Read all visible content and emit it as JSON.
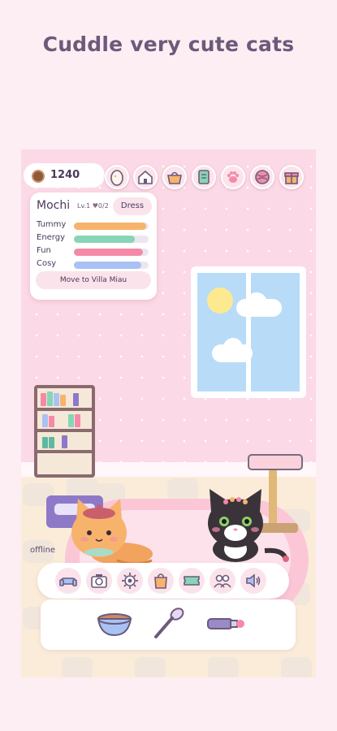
{
  "headline": "Cuddle very cute cats",
  "status": {
    "coins": "1240"
  },
  "top_icons": [
    "egg-icon",
    "home-icon",
    "basket-icon",
    "book-icon",
    "paw-icon",
    "yarn-ball-icon",
    "gift-icon"
  ],
  "cat_panel": {
    "name": "Mochi",
    "level": "Lv.1",
    "hearts": "0/2",
    "dress_label": "Dress",
    "stats": [
      {
        "label": "Tummy",
        "value": 0.97,
        "color": "#f7b36c"
      },
      {
        "label": "Energy",
        "value": 0.82,
        "color": "#86d5b6"
      },
      {
        "label": "Fun",
        "value": 0.92,
        "color": "#f48aa8"
      },
      {
        "label": "Cosy",
        "value": 0.9,
        "color": "#a9c2f4"
      }
    ],
    "move_label": "Move to Villa Miau"
  },
  "offline_label": "offline",
  "toolbar_icons": [
    "sofa-icon",
    "camera-icon",
    "settings-gear-icon",
    "shop-bag-icon",
    "ticket-icon",
    "friends-icon",
    "sound-icon"
  ],
  "tray_items": [
    "food-bowl-icon",
    "spoon-icon",
    "pen-toy-icon"
  ],
  "colors": {
    "background": "#fdeef3",
    "accent": "#f48aa8",
    "text": "#4a3a5a"
  }
}
